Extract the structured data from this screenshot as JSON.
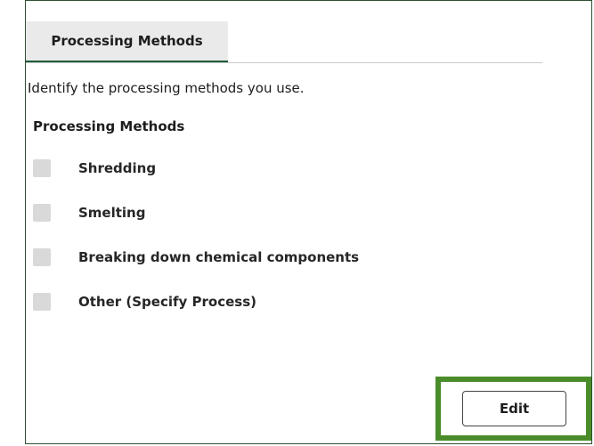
{
  "tabs": [
    {
      "label": "Processing Methods",
      "active": true
    }
  ],
  "instructions": "Identify the processing methods you use.",
  "section_title": "Processing Methods",
  "options": [
    {
      "label": "Shredding",
      "checked": false
    },
    {
      "label": "Smelting",
      "checked": false
    },
    {
      "label": "Breaking down chemical components",
      "checked": false
    },
    {
      "label": "Other (Specify Process)",
      "checked": false
    }
  ],
  "edit_label": "Edit",
  "colors": {
    "accent": "#1f5c3a",
    "highlight": "#4a8c2a",
    "checkbox": "#d9d9d9",
    "tab_bg": "#eaeaea"
  }
}
